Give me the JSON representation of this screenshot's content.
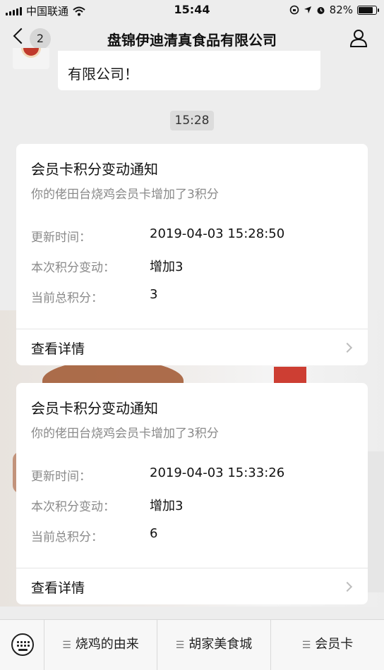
{
  "status_bar": {
    "carrier": "中国联通",
    "time": "15:44",
    "battery": "82%",
    "battery_level": 0.82
  },
  "nav": {
    "back_count": "2",
    "title": "盘锦伊迪清真食品有限公司"
  },
  "previous_message": {
    "text": "有限公司！"
  },
  "timestamp_chip": "15:28",
  "cards": [
    {
      "title": "会员卡积分变动通知",
      "subtitle": "你的佬田台烧鸡会员卡增加了3积分",
      "fields": [
        {
          "label": "更新时间：",
          "value": "2019-04-03 15:28:50"
        },
        {
          "label": "本次积分变动：",
          "value": "增加3"
        },
        {
          "label": "当前总积分：",
          "value": "3"
        }
      ],
      "detail_label": "查看详情"
    },
    {
      "title": "会员卡积分变动通知",
      "subtitle": "你的佬田台烧鸡会员卡增加了3积分",
      "fields": [
        {
          "label": "更新时间：",
          "value": "2019-04-03 15:33:26"
        },
        {
          "label": "本次积分变动：",
          "value": "增加3"
        },
        {
          "label": "当前总积分：",
          "value": "6"
        }
      ],
      "detail_label": "查看详情"
    }
  ],
  "bottom_menu": {
    "items": [
      {
        "label": "烧鸡的由来",
        "icon": "menu-lines-icon"
      },
      {
        "label": "胡家美食城",
        "icon": "menu-lines-icon"
      },
      {
        "label": "会员卡",
        "icon": "menu-lines-icon"
      }
    ]
  },
  "icons": {
    "back": "chevron-left-icon",
    "profile": "person-icon",
    "keyboard": "keyboard-icon"
  }
}
